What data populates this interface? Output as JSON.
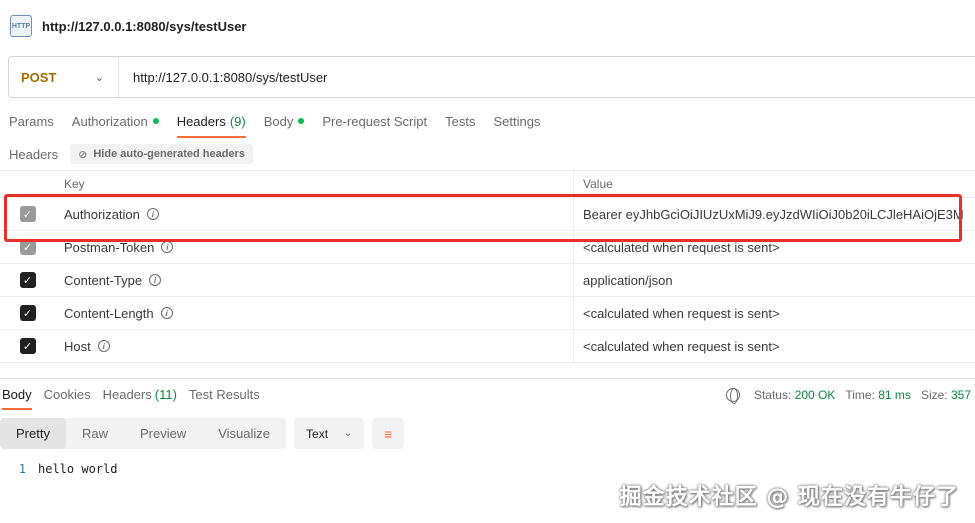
{
  "title_bar": {
    "icon_label": "HTTP",
    "title": "http://127.0.0.1:8080/sys/testUser"
  },
  "url_bar": {
    "method": "POST",
    "url": "http://127.0.0.1:8080/sys/testUser"
  },
  "request_tabs": [
    {
      "label": "Params",
      "count": "",
      "dot": false,
      "active": false
    },
    {
      "label": "Authorization",
      "count": "",
      "dot": true,
      "active": false
    },
    {
      "label": "Headers",
      "count": "(9)",
      "dot": false,
      "active": true
    },
    {
      "label": "Body",
      "count": "",
      "dot": true,
      "active": false
    },
    {
      "label": "Pre-request Script",
      "count": "",
      "dot": false,
      "active": false
    },
    {
      "label": "Tests",
      "count": "",
      "dot": false,
      "active": false
    },
    {
      "label": "Settings",
      "count": "",
      "dot": false,
      "active": false
    }
  ],
  "headers_section": {
    "label": "Headers",
    "hide_button": "Hide auto-generated headers"
  },
  "headers_table": {
    "columns": {
      "key": "Key",
      "value": "Value"
    },
    "rows": [
      {
        "key": "Authorization",
        "value": "Bearer eyJhbGciOiJIUzUxMiJ9.eyJzdWIiOiJ0b20iLCJleHAiOjE3M",
        "checked": true,
        "disabled": true
      },
      {
        "key": "Postman-Token",
        "value": "<calculated when request is sent>",
        "checked": true,
        "disabled": true
      },
      {
        "key": "Content-Type",
        "value": "application/json",
        "checked": true,
        "disabled": false
      },
      {
        "key": "Content-Length",
        "value": "<calculated when request is sent>",
        "checked": true,
        "disabled": false
      },
      {
        "key": "Host",
        "value": "<calculated when request is sent>",
        "checked": true,
        "disabled": false
      }
    ]
  },
  "response": {
    "tabs": [
      {
        "label": "Body",
        "count": "",
        "active": true
      },
      {
        "label": "Cookies",
        "count": "",
        "active": false
      },
      {
        "label": "Headers",
        "count": "(11)",
        "active": false
      },
      {
        "label": "Test Results",
        "count": "",
        "active": false
      }
    ],
    "status_label": "Status:",
    "status_value": "200 OK",
    "time_label": "Time:",
    "time_value": "81 ms",
    "size_label": "Size:",
    "size_value": "357"
  },
  "view_modes": [
    {
      "label": "Pretty",
      "active": true
    },
    {
      "label": "Raw",
      "active": false
    },
    {
      "label": "Preview",
      "active": false
    },
    {
      "label": "Visualize",
      "active": false
    }
  ],
  "format_select": "Text",
  "body_lines": [
    {
      "no": "1",
      "text": "hello world"
    }
  ],
  "watermark": "掘金技术社区 @ 现在没有牛仔了",
  "colors": {
    "accent": "#ff6c37",
    "highlight": "#e8302a",
    "success": "#0a8a3a",
    "method": "#a06b00"
  }
}
